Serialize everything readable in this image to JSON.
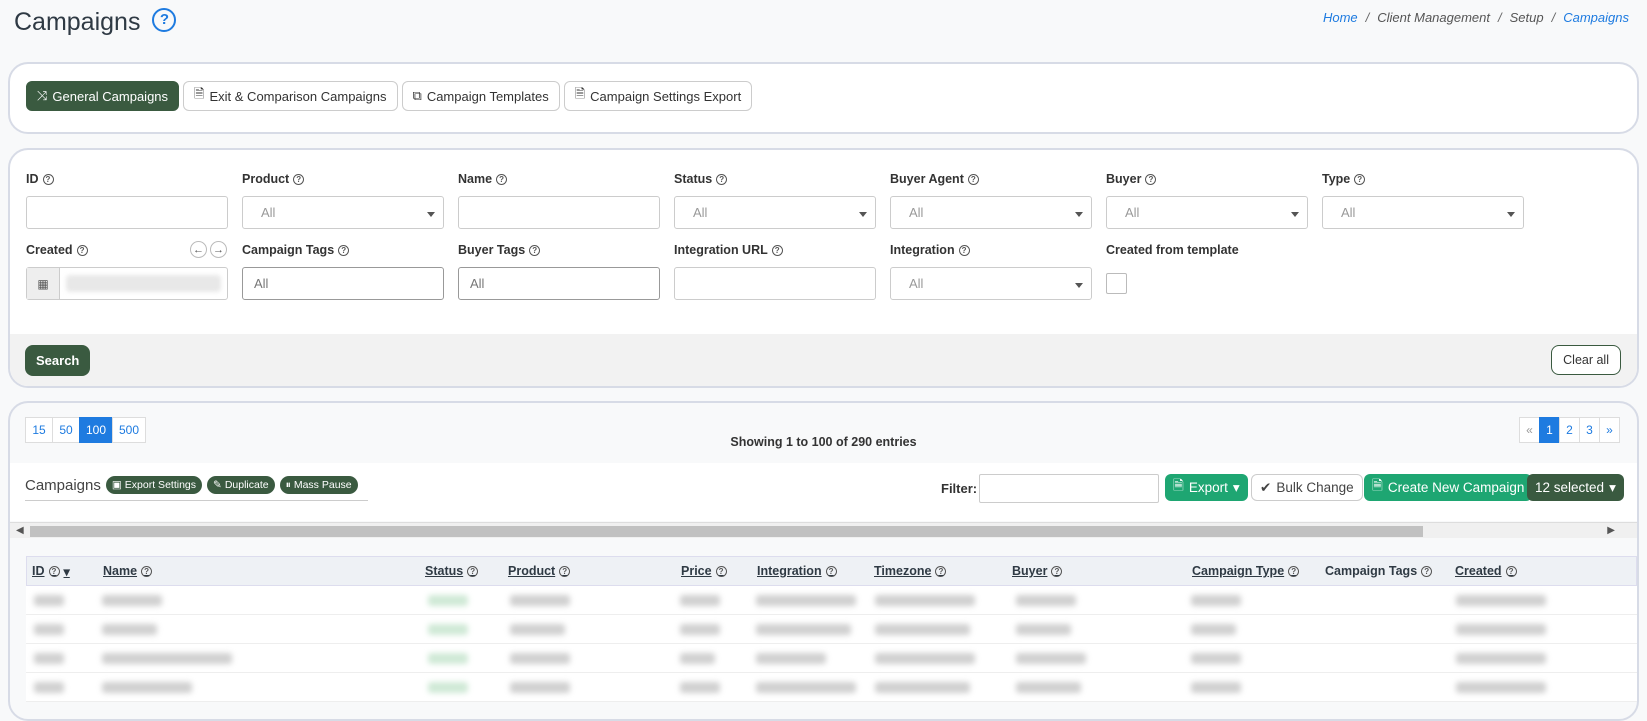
{
  "page": {
    "title": "Campaigns",
    "help": "?"
  },
  "breadcrumb": {
    "home": "Home",
    "client": "Client Management",
    "setup": "Setup",
    "current": "Campaigns",
    "sep": "/"
  },
  "tabs": [
    {
      "label": "General Campaigns",
      "icon": "shuffle-icon"
    },
    {
      "label": "Exit & Comparison Campaigns",
      "icon": "file-icon"
    },
    {
      "label": "Campaign Templates",
      "icon": "copy-icon"
    },
    {
      "label": "Campaign Settings Export",
      "icon": "file-export-icon"
    }
  ],
  "filters": {
    "id": "ID",
    "product": "Product",
    "name": "Name",
    "status": "Status",
    "buyer_agent": "Buyer Agent",
    "buyer": "Buyer",
    "type": "Type",
    "created": "Created",
    "campaign_tags": "Campaign Tags",
    "buyer_tags": "Buyer Tags",
    "integration_url": "Integration URL",
    "integration": "Integration",
    "created_from_template": "Created from template",
    "all": "All"
  },
  "actions": {
    "search": "Search",
    "clear": "Clear all"
  },
  "paging": {
    "sizes": [
      "15",
      "50",
      "100",
      "500"
    ],
    "showing": "Showing 1 to 100 of 290 entries",
    "pages": [
      "«",
      "1",
      "2",
      "3",
      "»"
    ]
  },
  "toolbar": {
    "title": "Campaigns",
    "export_settings": "Export Settings",
    "duplicate": "Duplicate",
    "mass_pause": "Mass Pause",
    "filter_label": "Filter:",
    "export": "Export",
    "bulk_change": "Bulk Change",
    "create_new": "Create New Campaign",
    "selected": "12 selected"
  },
  "columns": [
    "ID",
    "Name",
    "Status",
    "Product",
    "Price",
    "Integration",
    "Timezone",
    "Buyer",
    "Campaign Type",
    "Campaign Tags",
    "Created"
  ],
  "colors": {
    "primary_dark": "#3a5a40",
    "green": "#1ea672",
    "blue": "#1e7be0"
  }
}
